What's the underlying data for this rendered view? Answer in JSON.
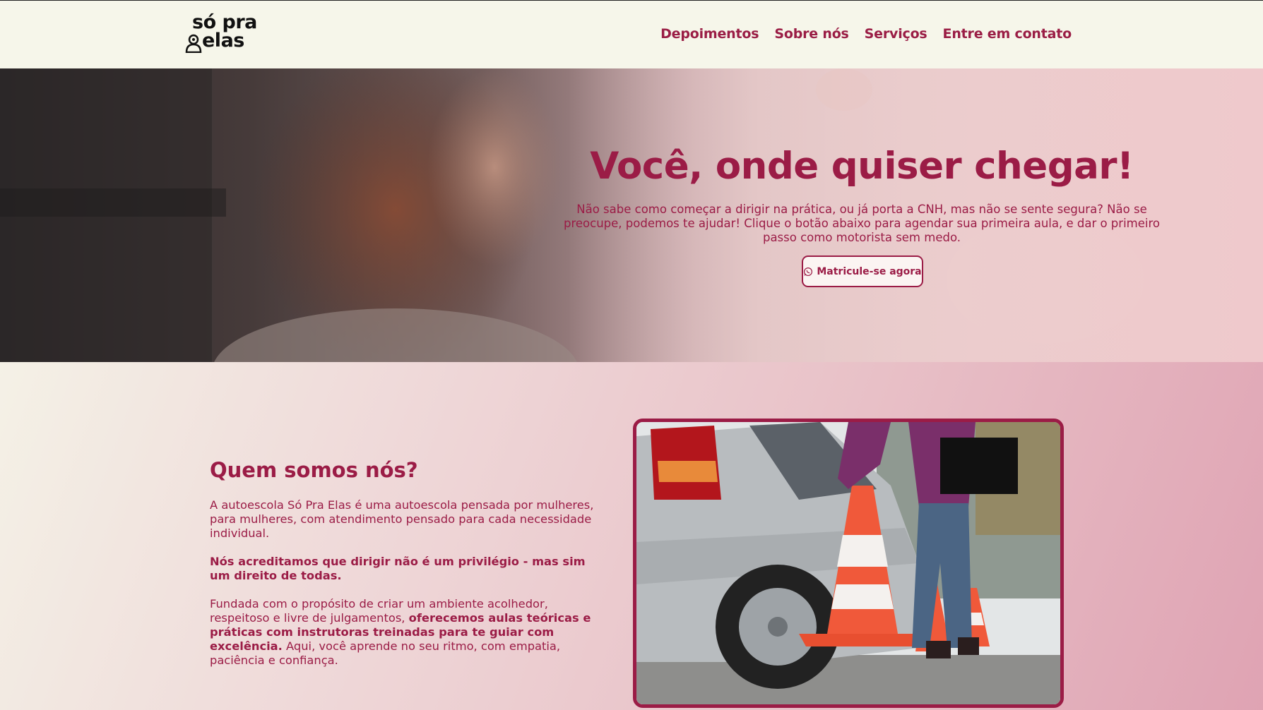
{
  "header": {
    "logo": {
      "line1": "só pra",
      "line2": "elas"
    },
    "nav": [
      {
        "label": "Depoimentos"
      },
      {
        "label": "Sobre nós"
      },
      {
        "label": "Serviços"
      },
      {
        "label": "Entre em contato"
      }
    ]
  },
  "hero": {
    "title": "Você, onde quiser chegar!",
    "text": "Não sabe como começar a dirigir na prática, ou já porta a CNH, mas não se sente segura? Não se preocupe, podemos te ajudar! Clique o botão abaixo para agendar sua primeira aula, e dar o primeiro passo como motorista sem medo.",
    "button_label": "Matricule-se agora",
    "button_icon": "whatsapp-icon"
  },
  "about": {
    "title": "Quem somos nós?",
    "p1": "A autoescola Só Pra Elas é uma autoescola pensada por mulheres, para mulheres, com atendimento pensado para cada necessidade individual.",
    "p2_bold": "Nós acreditamos que dirigir não é um privilégio - mas sim um direito de todas.",
    "p3_a": "Fundada com o propósito de criar um ambiente acolhedor, respeitoso e livre de julgamentos, ",
    "p3_bold": "oferecemos aulas teóricas e práticas com instrutoras treinadas para te guiar com excelência.",
    "p3_b": " Aqui, você aprende no seu ritmo, com empatia, paciência e confiança."
  },
  "colors": {
    "brand": "#9b1c46",
    "header_bg": "#f6f6ea"
  }
}
